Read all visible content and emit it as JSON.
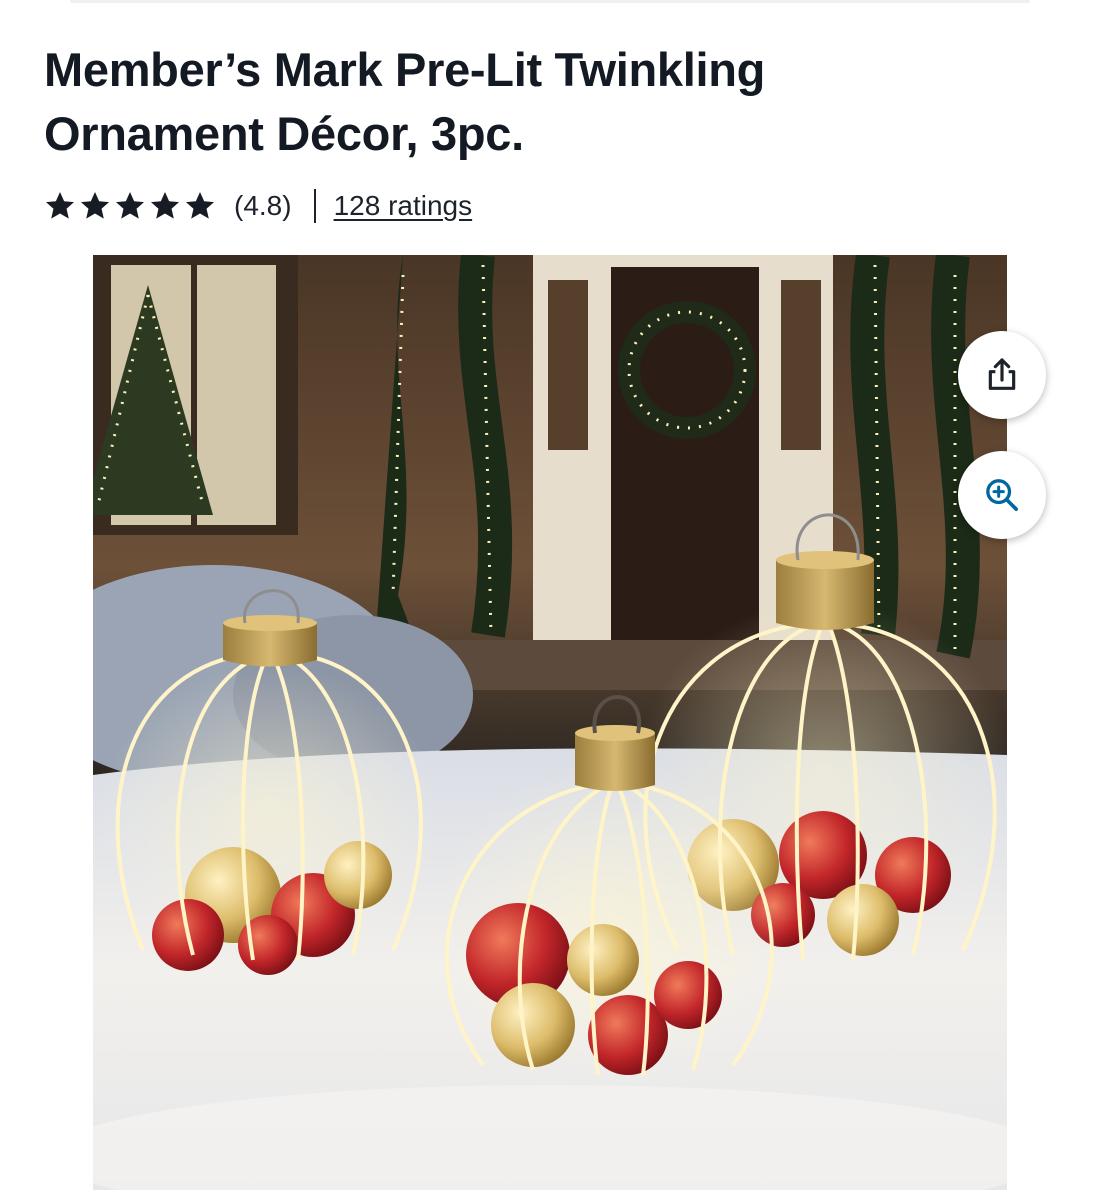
{
  "product": {
    "title": "Member’s Mark Pre-Lit Twinkling Ornament Décor, 3pc.",
    "rating": {
      "stars_filled": 5,
      "stars_total": 5,
      "value_text": "(4.8)",
      "ratings_link": "128 ratings"
    },
    "image": {
      "subject": "three lit wire ornament-shaped decorations filled with red and gold ornaments on snow in front of a house"
    }
  },
  "actions": {
    "share_icon": "share-icon",
    "zoom_icon": "zoom-in-icon"
  },
  "colors": {
    "text": "#141a24",
    "accent_blue": "#0067a0",
    "lights": "#fff4c8",
    "ornament_red": "#b8202a",
    "ornament_gold": "#d8b560"
  }
}
